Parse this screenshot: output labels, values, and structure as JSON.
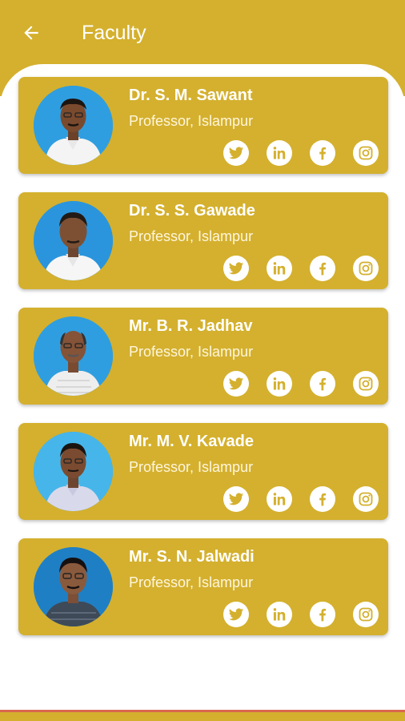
{
  "header": {
    "title": "Faculty",
    "back_icon": "arrow-back-icon"
  },
  "colors": {
    "primary": "#d4b02e",
    "card_text": "#ffffff",
    "icon_glyph": "#d4b02e",
    "bottom_accent": "#d9674f"
  },
  "faculty": [
    {
      "name": "Dr. S. M. Sawant",
      "role": "Professor, Islampur"
    },
    {
      "name": "Dr. S. S. Gawade",
      "role": "Professor, Islampur"
    },
    {
      "name": "Mr. B. R. Jadhav",
      "role": "Professor, Islampur"
    },
    {
      "name": "Mr. M. V. Kavade",
      "role": "Professor, Islampur"
    },
    {
      "name": "Mr. S. N. Jalwadi",
      "role": "Professor, Islampur"
    }
  ],
  "social_icons": [
    "twitter-icon",
    "linkedin-icon",
    "facebook-icon",
    "instagram-icon"
  ]
}
